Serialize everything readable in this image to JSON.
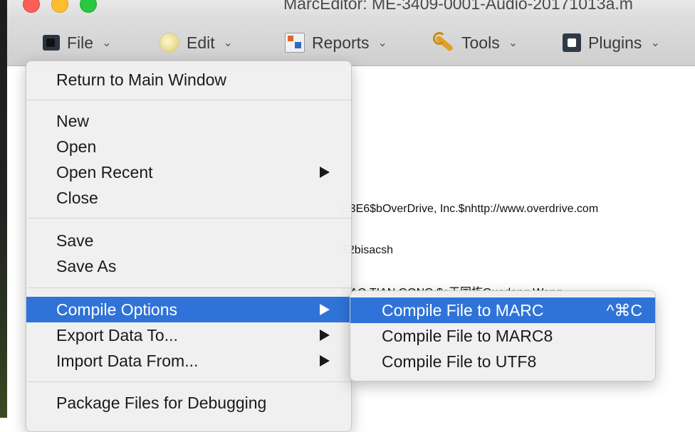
{
  "window": {
    "title": "MarcEditor: ME-3409-0001-Audio-20171013a.m"
  },
  "toolbar": {
    "items": [
      {
        "label": "File",
        "icon": "file-icon"
      },
      {
        "label": "Edit",
        "icon": "edit-icon"
      },
      {
        "label": "Reports",
        "icon": "reports-icon"
      },
      {
        "label": "Tools",
        "icon": "wrench-icon"
      },
      {
        "label": "Plugins",
        "icon": "puzzle-icon"
      }
    ],
    "chevron": "⌄"
  },
  "content": {
    "lines": [
      "E3E6$bOverDrive, Inc.$nhttp://www.overdrive.com",
      "$2bisacsh",
      "NAO TIAN GONG $c王国栋Guodong Wang"
    ]
  },
  "file_menu": {
    "items": [
      {
        "label": "Return to Main Window"
      },
      {
        "label": "New"
      },
      {
        "label": "Open"
      },
      {
        "label": "Open Recent",
        "submenu": true
      },
      {
        "label": "Close"
      },
      {
        "label": "Save"
      },
      {
        "label": "Save As"
      },
      {
        "label": "Compile Options",
        "submenu": true,
        "highlighted": true
      },
      {
        "label": "Export Data To...",
        "submenu": true
      },
      {
        "label": "Import Data From...",
        "submenu": true
      },
      {
        "label": "Package Files for Debugging"
      }
    ]
  },
  "compile_submenu": {
    "items": [
      {
        "label": "Compile File to MARC",
        "shortcut": "^⌘C",
        "highlighted": true
      },
      {
        "label": "Compile File to MARC8"
      },
      {
        "label": "Compile File to UTF8"
      }
    ]
  },
  "colors": {
    "highlight": "#2f73d9",
    "menu_bg": "#f0f0f0"
  }
}
